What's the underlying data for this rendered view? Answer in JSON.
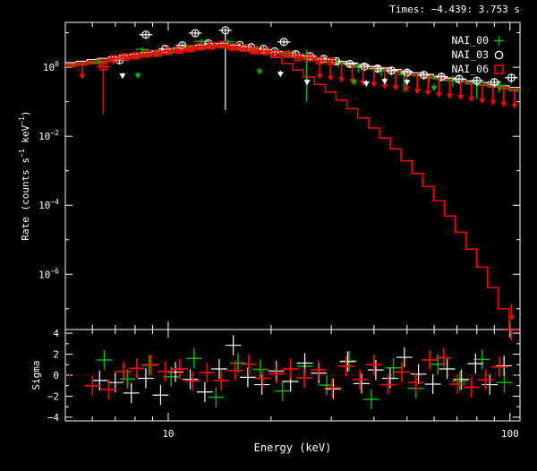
{
  "title": "Times: −4.439: 3.753 s",
  "colors": {
    "bg": "#000000",
    "frame": "#ffffff",
    "red": "#ff0000",
    "green": "#00b400",
    "white": "#ffffff"
  },
  "legend": [
    {
      "label": "NAI_00",
      "marker": "plus-marker",
      "color": "#00b400"
    },
    {
      "label": "NAI_03",
      "marker": "circle-marker",
      "color": "#ffffff"
    },
    {
      "label": "NAI_06",
      "marker": "square-marker",
      "color": "#ff0000"
    }
  ],
  "axes": {
    "xlabel": "Energy (keV)",
    "sigma_label": "Sigma",
    "ylabel_parts": [
      "Rate (counts s",
      "−1",
      " keV",
      "−1",
      ")"
    ],
    "xtick_labels": [
      {
        "value": 10,
        "label": "10"
      },
      {
        "value": 100,
        "label": "100"
      }
    ],
    "xticks_minor": [
      6,
      7,
      8,
      9,
      20,
      30,
      40,
      50,
      60,
      70,
      80,
      90
    ],
    "ytick_major_exponents": [
      "0",
      "−2",
      "−4",
      "−6"
    ],
    "ytick_major_values": [
      1,
      0.01,
      0.0001,
      1e-06
    ],
    "ytick_minor_values": [
      10,
      0.1,
      0.001,
      1e-05,
      1e-07
    ],
    "sigma_tick_labels": [
      "4",
      "2",
      "0",
      "−2",
      "−4"
    ],
    "sigma_tick_major": [
      4,
      2,
      0,
      -2,
      -4
    ],
    "sigma_tick_minor": [
      3,
      1,
      -1,
      -3
    ]
  },
  "chart_data": {
    "type": "line",
    "title": "Times: −4.439: 3.753 s",
    "xlabel": "Energy (keV)",
    "ylabel": "Rate (counts s^-1 keV^-1)",
    "ylabel_bottom": "Sigma",
    "x_scale": "log",
    "y_scale_top": "log",
    "x_range": [
      5,
      107
    ],
    "y_range_top": [
      2.5e-08,
      20
    ],
    "y_range_bottom": [
      -4.35,
      4.35
    ],
    "legend_position": "top-right-inside",
    "bin_edges_kev": [
      5.0,
      5.38,
      5.79,
      6.22,
      6.7,
      7.2,
      7.75,
      8.33,
      8.96,
      9.64,
      10.37,
      11.16,
      12.0,
      12.91,
      13.89,
      14.94,
      16.07,
      17.28,
      18.59,
      20.0,
      21.51,
      23.14,
      24.89,
      26.78,
      28.8,
      30.98,
      33.33,
      35.85,
      38.57,
      41.48,
      44.62,
      48.0,
      51.63,
      55.53,
      59.74,
      64.26,
      69.12,
      74.35,
      79.98,
      86.03,
      92.54,
      99.54,
      107.0
    ],
    "model_red": [
      1.21,
      1.33,
      1.47,
      1.62,
      1.78,
      1.97,
      2.17,
      2.4,
      2.64,
      2.92,
      3.22,
      3.56,
      3.92,
      4.33,
      4.41,
      3.95,
      3.54,
      3.18,
      2.85,
      2.55,
      2.29,
      2.05,
      1.84,
      1.65,
      1.48,
      1.32,
      1.19,
      1.06,
      0.95,
      0.85,
      0.77,
      0.69,
      0.61,
      0.55,
      0.49,
      0.44,
      0.4,
      0.36,
      0.32,
      0.29,
      0.26,
      0.23
    ],
    "model_red_cutoff": [
      1.05,
      1.16,
      1.28,
      1.41,
      1.55,
      1.71,
      1.89,
      2.09,
      2.3,
      2.54,
      2.8,
      3.1,
      3.41,
      3.77,
      3.84,
      3.44,
      3.08,
      2.77,
      2.48,
      1.92,
      1.28,
      0.83,
      0.52,
      0.32,
      0.19,
      0.111,
      0.063,
      0.034,
      0.0174,
      0.0089,
      0.0043,
      0.00194,
      0.00084,
      0.00035,
      0.000135,
      4.87e-05,
      1.65e-05,
      5.3e-06,
      1.6e-06,
      4.1e-07,
      1e-07,
      2.3e-08
    ],
    "model_white": [
      1.36,
      1.49,
      1.65,
      1.81,
      1.99,
      2.21,
      2.43,
      2.69,
      2.96,
      3.27,
      3.61,
      3.99,
      4.39,
      4.85,
      4.94,
      4.42,
      3.96,
      3.56,
      3.19,
      2.86,
      2.56,
      2.3,
      2.06,
      1.85,
      1.66,
      1.48,
      1.33,
      1.19,
      1.06,
      0.95,
      0.86,
      0.77,
      0.69,
      0.62,
      0.55,
      0.49,
      0.45,
      0.4,
      0.36,
      0.32,
      0.29,
      0.26
    ],
    "model_green": [
      1.13,
      1.24,
      1.37,
      1.51,
      1.66,
      1.83,
      2.02,
      2.23,
      2.46,
      2.72,
      2.99,
      3.31,
      3.65,
      4.03,
      4.1,
      3.67,
      3.29,
      2.96,
      2.65,
      2.37,
      2.13,
      1.91,
      1.71,
      1.53,
      1.38,
      1.23,
      1.11,
      0.99,
      0.89,
      0.79,
      0.72,
      0.64,
      0.57,
      0.51,
      0.46,
      0.41,
      0.37,
      0.33,
      0.3,
      0.27,
      0.24,
      0.21
    ],
    "points_red": [
      [
        6.46,
        1.05,
        0.044,
        1.5
      ],
      [
        6.94,
        1.75,
        1.2,
        2.2
      ],
      [
        7.47,
        2.0,
        1.55,
        2.45
      ],
      [
        8.03,
        2.15,
        1.7,
        2.6
      ],
      [
        8.64,
        2.45,
        2.0,
        2.95
      ],
      [
        9.29,
        2.55,
        2.1,
        3.0
      ],
      [
        10.0,
        2.95,
        2.5,
        3.4
      ],
      [
        10.75,
        3.15,
        2.7,
        3.6
      ],
      [
        11.57,
        3.5,
        3.05,
        3.95
      ],
      [
        12.44,
        3.95,
        3.5,
        4.4
      ],
      [
        13.39,
        4.15,
        3.7,
        4.6
      ],
      [
        14.4,
        4.5,
        4.05,
        4.95
      ],
      [
        15.49,
        3.85,
        3.4,
        4.3
      ],
      [
        16.66,
        3.6,
        3.15,
        4.05
      ],
      [
        17.92,
        3.05,
        2.65,
        3.5
      ],
      [
        19.28,
        2.9,
        2.5,
        3.3
      ],
      [
        20.74,
        2.45,
        2.1,
        2.85
      ],
      [
        22.31,
        2.35,
        2.0,
        2.7
      ],
      [
        24.0,
        1.95,
        1.6,
        2.3
      ],
      [
        25.81,
        1.9,
        1.55,
        2.25
      ],
      [
        27.77,
        1.55,
        1.2,
        1.9
      ],
      [
        29.87,
        1.5,
        1.15,
        1.85
      ]
    ],
    "points_white": [
      [
        7.2,
        1.6,
        1.2,
        2.1
      ],
      [
        8.6,
        8.8,
        7.2,
        10.4
      ],
      [
        9.8,
        3.4,
        2.8,
        4.0
      ],
      [
        11.0,
        4.3,
        3.6,
        5.0
      ],
      [
        12.0,
        9.8,
        8.2,
        11.6
      ],
      [
        13.1,
        4.9,
        4.2,
        5.7
      ],
      [
        14.7,
        11.8,
        0.057,
        13.9
      ],
      [
        16.2,
        4.4,
        3.7,
        5.1
      ],
      [
        17.5,
        3.8,
        3.2,
        4.4
      ],
      [
        19.0,
        3.4,
        2.8,
        4.0
      ],
      [
        20.5,
        2.9,
        2.4,
        3.4
      ],
      [
        21.8,
        5.4,
        4.5,
        6.3
      ],
      [
        23.6,
        2.4,
        1.95,
        2.85
      ],
      [
        26.0,
        2.1,
        1.7,
        2.5
      ],
      [
        28.5,
        1.75,
        1.4,
        2.1
      ],
      [
        31.0,
        1.5,
        1.2,
        1.8
      ],
      [
        34.0,
        1.25,
        1.0,
        1.5
      ],
      [
        37.5,
        1.05,
        0.8,
        1.3
      ],
      [
        41.0,
        0.92,
        0.7,
        1.14
      ],
      [
        45.0,
        0.8,
        0.6,
        1.0
      ],
      [
        50.0,
        0.7,
        0.52,
        0.88
      ],
      [
        56.0,
        0.6,
        0.44,
        0.76
      ],
      [
        63.0,
        0.53,
        0.39,
        0.67
      ],
      [
        71.0,
        0.46,
        0.33,
        0.59
      ],
      [
        80.0,
        0.41,
        0.29,
        0.53
      ],
      [
        90.0,
        0.37,
        0.26,
        0.48
      ],
      [
        101.0,
        0.5,
        0.36,
        0.64
      ]
    ],
    "points_green": [
      [
        6.3,
        1.35,
        1.0,
        1.7
      ],
      [
        7.1,
        1.8,
        1.4,
        2.2
      ],
      [
        8.4,
        3.3,
        2.7,
        3.9
      ],
      [
        9.2,
        2.5,
        2.0,
        3.0
      ],
      [
        10.3,
        3.1,
        2.5,
        3.7
      ],
      [
        11.4,
        3.9,
        3.2,
        4.6
      ],
      [
        12.5,
        5.6,
        4.7,
        6.5
      ],
      [
        13.5,
        4.2,
        3.5,
        4.9
      ],
      [
        15.0,
        5.5,
        4.6,
        6.4
      ],
      [
        16.5,
        4.3,
        3.5,
        5.1
      ],
      [
        18.2,
        3.6,
        2.9,
        4.3
      ],
      [
        20.0,
        2.7,
        2.1,
        3.3
      ],
      [
        22.5,
        2.6,
        2.0,
        3.2
      ],
      [
        25.4,
        2.1,
        0.1,
        3.3
      ],
      [
        28.0,
        1.6,
        1.2,
        2.0
      ],
      [
        31.5,
        1.35,
        1.0,
        1.7
      ],
      [
        36.0,
        1.0,
        0.7,
        1.3
      ],
      [
        42.0,
        0.8,
        0.55,
        1.05
      ],
      [
        49.0,
        0.62,
        0.2,
        0.85
      ],
      [
        58.0,
        0.5,
        0.33,
        0.67
      ],
      [
        68.0,
        0.42,
        0.27,
        0.57
      ],
      [
        80.0,
        0.36,
        0.12,
        0.5
      ],
      [
        93.0,
        0.3,
        0.19,
        0.41
      ]
    ],
    "upper_limits_red": [
      [
        5.6,
        1.21,
        0.45
      ],
      [
        27.77,
        1.65,
        0.45
      ],
      [
        29.87,
        1.48,
        0.4
      ],
      [
        32.13,
        1.32,
        0.36
      ],
      [
        34.56,
        1.19,
        0.32
      ],
      [
        37.18,
        1.06,
        0.29
      ],
      [
        39.99,
        0.95,
        0.26
      ],
      [
        43.02,
        0.85,
        0.23
      ],
      [
        46.27,
        0.77,
        0.21
      ],
      [
        49.78,
        0.69,
        0.19
      ],
      [
        53.54,
        0.61,
        0.165
      ],
      [
        57.59,
        0.55,
        0.15
      ],
      [
        61.95,
        0.49,
        0.13
      ],
      [
        66.64,
        0.44,
        0.12
      ],
      [
        71.68,
        0.4,
        0.11
      ],
      [
        77.1,
        0.36,
        0.097
      ],
      [
        82.94,
        0.32,
        0.086
      ],
      [
        89.22,
        0.29,
        0.078
      ],
      [
        95.97,
        0.26,
        0.07
      ],
      [
        103.2,
        0.23,
        0.062
      ],
      [
        101.0,
        1.4e-07,
        4.5e-08
      ]
    ],
    "upper_limits_white": [
      [
        7.35,
        0.68,
        0.46
      ],
      [
        21.3,
        0.8,
        0.52
      ],
      [
        25.5,
        0.45,
        0.3
      ],
      [
        38.0,
        0.42,
        0.27
      ],
      [
        43.0,
        0.5,
        0.32
      ],
      [
        50.0,
        0.45,
        0.3
      ]
    ],
    "upper_limits_green": [
      [
        8.15,
        0.72,
        0.46
      ],
      [
        18.5,
        0.95,
        0.6
      ],
      [
        35.0,
        0.5,
        0.3
      ],
      [
        60.0,
        0.33,
        0.2
      ]
    ],
    "residuals_red": [
      [
        6.0,
        -1.0
      ],
      [
        6.7,
        -1.35
      ],
      [
        7.4,
        0.35
      ],
      [
        8.1,
        0.65
      ],
      [
        8.9,
        1.0
      ],
      [
        9.8,
        0.35
      ],
      [
        10.8,
        0.6
      ],
      [
        11.8,
        -0.55
      ],
      [
        13.0,
        0.25
      ],
      [
        14.3,
        -0.5
      ],
      [
        15.7,
        0.45
      ],
      [
        17.2,
        1.05
      ],
      [
        18.9,
        -0.3
      ],
      [
        20.8,
        0.15
      ],
      [
        22.8,
        0.6
      ],
      [
        25.0,
        -0.25
      ],
      [
        27.5,
        0.5
      ],
      [
        30.2,
        -1.2
      ],
      [
        33.2,
        0.85
      ],
      [
        36.4,
        -0.4
      ],
      [
        40.0,
        1.0
      ],
      [
        44.0,
        -0.9
      ],
      [
        48.3,
        0.3
      ],
      [
        53.0,
        -0.7
      ],
      [
        58.2,
        1.45
      ],
      [
        64.0,
        1.65
      ],
      [
        70.3,
        -0.85
      ],
      [
        77.2,
        -1.15
      ],
      [
        84.8,
        -0.45
      ],
      [
        93.1,
        0.8
      ],
      [
        101.0,
        4.3
      ]
    ],
    "residuals_white": [
      [
        6.3,
        -0.5
      ],
      [
        7.0,
        -0.7
      ],
      [
        7.8,
        -1.7
      ],
      [
        8.6,
        -0.3
      ],
      [
        9.5,
        -1.9
      ],
      [
        10.5,
        0.3
      ],
      [
        11.6,
        -0.4
      ],
      [
        12.8,
        -1.6
      ],
      [
        14.1,
        0.6
      ],
      [
        15.5,
        2.85
      ],
      [
        17.1,
        -0.2
      ],
      [
        18.8,
        -0.9
      ],
      [
        20.7,
        0.4
      ],
      [
        22.8,
        -0.6
      ],
      [
        25.1,
        1.15
      ],
      [
        27.6,
        0.2
      ],
      [
        30.4,
        -1.3
      ],
      [
        33.5,
        1.3
      ],
      [
        36.8,
        -0.8
      ],
      [
        40.5,
        0.5
      ],
      [
        44.6,
        -0.3
      ],
      [
        49.1,
        1.7
      ],
      [
        54.0,
        0.1
      ],
      [
        59.5,
        -0.85
      ],
      [
        65.5,
        0.6
      ],
      [
        72.1,
        -0.4
      ],
      [
        79.3,
        1.1
      ],
      [
        87.3,
        -0.9
      ],
      [
        96.1,
        0.9
      ]
    ],
    "residuals_green": [
      [
        6.5,
        1.45
      ],
      [
        7.6,
        -0.35
      ],
      [
        8.8,
        0.95
      ],
      [
        10.2,
        -0.15
      ],
      [
        11.9,
        1.6
      ],
      [
        13.8,
        -2.1
      ],
      [
        16.0,
        1.15
      ],
      [
        18.6,
        0.55
      ],
      [
        21.6,
        -1.5
      ],
      [
        25.1,
        0.85
      ],
      [
        29.1,
        -0.95
      ],
      [
        33.8,
        1.35
      ],
      [
        39.3,
        -2.3
      ],
      [
        45.6,
        0.7
      ],
      [
        53.0,
        -1.25
      ],
      [
        61.5,
        1.05
      ],
      [
        71.4,
        -0.55
      ],
      [
        82.9,
        1.5
      ],
      [
        96.3,
        -0.7
      ]
    ],
    "residual_err_half": 0.95,
    "zero_line": {
      "color": "#ff0000",
      "style": "dotted"
    }
  }
}
